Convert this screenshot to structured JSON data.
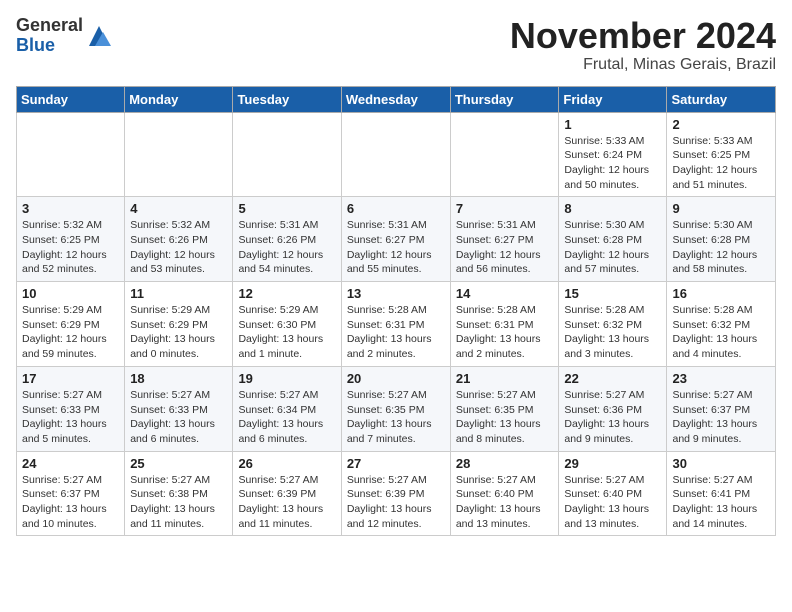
{
  "logo": {
    "general": "General",
    "blue": "Blue"
  },
  "title": {
    "month_year": "November 2024",
    "location": "Frutal, Minas Gerais, Brazil"
  },
  "days_of_week": [
    "Sunday",
    "Monday",
    "Tuesday",
    "Wednesday",
    "Thursday",
    "Friday",
    "Saturday"
  ],
  "weeks": [
    [
      {
        "day": "",
        "info": ""
      },
      {
        "day": "",
        "info": ""
      },
      {
        "day": "",
        "info": ""
      },
      {
        "day": "",
        "info": ""
      },
      {
        "day": "",
        "info": ""
      },
      {
        "day": "1",
        "info": "Sunrise: 5:33 AM\nSunset: 6:24 PM\nDaylight: 12 hours and 50 minutes."
      },
      {
        "day": "2",
        "info": "Sunrise: 5:33 AM\nSunset: 6:25 PM\nDaylight: 12 hours and 51 minutes."
      }
    ],
    [
      {
        "day": "3",
        "info": "Sunrise: 5:32 AM\nSunset: 6:25 PM\nDaylight: 12 hours and 52 minutes."
      },
      {
        "day": "4",
        "info": "Sunrise: 5:32 AM\nSunset: 6:26 PM\nDaylight: 12 hours and 53 minutes."
      },
      {
        "day": "5",
        "info": "Sunrise: 5:31 AM\nSunset: 6:26 PM\nDaylight: 12 hours and 54 minutes."
      },
      {
        "day": "6",
        "info": "Sunrise: 5:31 AM\nSunset: 6:27 PM\nDaylight: 12 hours and 55 minutes."
      },
      {
        "day": "7",
        "info": "Sunrise: 5:31 AM\nSunset: 6:27 PM\nDaylight: 12 hours and 56 minutes."
      },
      {
        "day": "8",
        "info": "Sunrise: 5:30 AM\nSunset: 6:28 PM\nDaylight: 12 hours and 57 minutes."
      },
      {
        "day": "9",
        "info": "Sunrise: 5:30 AM\nSunset: 6:28 PM\nDaylight: 12 hours and 58 minutes."
      }
    ],
    [
      {
        "day": "10",
        "info": "Sunrise: 5:29 AM\nSunset: 6:29 PM\nDaylight: 12 hours and 59 minutes."
      },
      {
        "day": "11",
        "info": "Sunrise: 5:29 AM\nSunset: 6:29 PM\nDaylight: 13 hours and 0 minutes."
      },
      {
        "day": "12",
        "info": "Sunrise: 5:29 AM\nSunset: 6:30 PM\nDaylight: 13 hours and 1 minute."
      },
      {
        "day": "13",
        "info": "Sunrise: 5:28 AM\nSunset: 6:31 PM\nDaylight: 13 hours and 2 minutes."
      },
      {
        "day": "14",
        "info": "Sunrise: 5:28 AM\nSunset: 6:31 PM\nDaylight: 13 hours and 2 minutes."
      },
      {
        "day": "15",
        "info": "Sunrise: 5:28 AM\nSunset: 6:32 PM\nDaylight: 13 hours and 3 minutes."
      },
      {
        "day": "16",
        "info": "Sunrise: 5:28 AM\nSunset: 6:32 PM\nDaylight: 13 hours and 4 minutes."
      }
    ],
    [
      {
        "day": "17",
        "info": "Sunrise: 5:27 AM\nSunset: 6:33 PM\nDaylight: 13 hours and 5 minutes."
      },
      {
        "day": "18",
        "info": "Sunrise: 5:27 AM\nSunset: 6:33 PM\nDaylight: 13 hours and 6 minutes."
      },
      {
        "day": "19",
        "info": "Sunrise: 5:27 AM\nSunset: 6:34 PM\nDaylight: 13 hours and 6 minutes."
      },
      {
        "day": "20",
        "info": "Sunrise: 5:27 AM\nSunset: 6:35 PM\nDaylight: 13 hours and 7 minutes."
      },
      {
        "day": "21",
        "info": "Sunrise: 5:27 AM\nSunset: 6:35 PM\nDaylight: 13 hours and 8 minutes."
      },
      {
        "day": "22",
        "info": "Sunrise: 5:27 AM\nSunset: 6:36 PM\nDaylight: 13 hours and 9 minutes."
      },
      {
        "day": "23",
        "info": "Sunrise: 5:27 AM\nSunset: 6:37 PM\nDaylight: 13 hours and 9 minutes."
      }
    ],
    [
      {
        "day": "24",
        "info": "Sunrise: 5:27 AM\nSunset: 6:37 PM\nDaylight: 13 hours and 10 minutes."
      },
      {
        "day": "25",
        "info": "Sunrise: 5:27 AM\nSunset: 6:38 PM\nDaylight: 13 hours and 11 minutes."
      },
      {
        "day": "26",
        "info": "Sunrise: 5:27 AM\nSunset: 6:39 PM\nDaylight: 13 hours and 11 minutes."
      },
      {
        "day": "27",
        "info": "Sunrise: 5:27 AM\nSunset: 6:39 PM\nDaylight: 13 hours and 12 minutes."
      },
      {
        "day": "28",
        "info": "Sunrise: 5:27 AM\nSunset: 6:40 PM\nDaylight: 13 hours and 13 minutes."
      },
      {
        "day": "29",
        "info": "Sunrise: 5:27 AM\nSunset: 6:40 PM\nDaylight: 13 hours and 13 minutes."
      },
      {
        "day": "30",
        "info": "Sunrise: 5:27 AM\nSunset: 6:41 PM\nDaylight: 13 hours and 14 minutes."
      }
    ]
  ]
}
